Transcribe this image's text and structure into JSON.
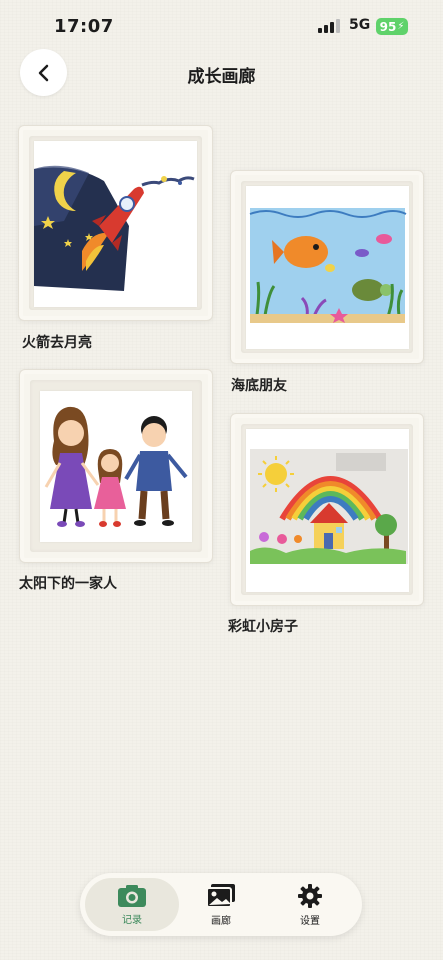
{
  "status_bar": {
    "time": "17:07",
    "network": "5G",
    "battery": "95"
  },
  "header": {
    "title": "成长画廊"
  },
  "gallery": [
    {
      "title": "火箭去月亮",
      "art_icon": "rocket-moon-drawing"
    },
    {
      "title": "海底朋友",
      "art_icon": "underwater-drawing"
    },
    {
      "title": "太阳下的一家人",
      "art_icon": "family-drawing"
    },
    {
      "title": "彩虹小房子",
      "art_icon": "rainbow-house-drawing"
    }
  ],
  "tabbar": {
    "items": [
      {
        "label": "记录",
        "icon": "camera-icon",
        "active": true
      },
      {
        "label": "画廊",
        "icon": "gallery-icon",
        "active": false
      },
      {
        "label": "设置",
        "icon": "gear-icon",
        "active": false
      }
    ]
  },
  "colors": {
    "accent": "#3d8a5c",
    "background": "#f3f1ea",
    "battery": "#5fd26a"
  }
}
